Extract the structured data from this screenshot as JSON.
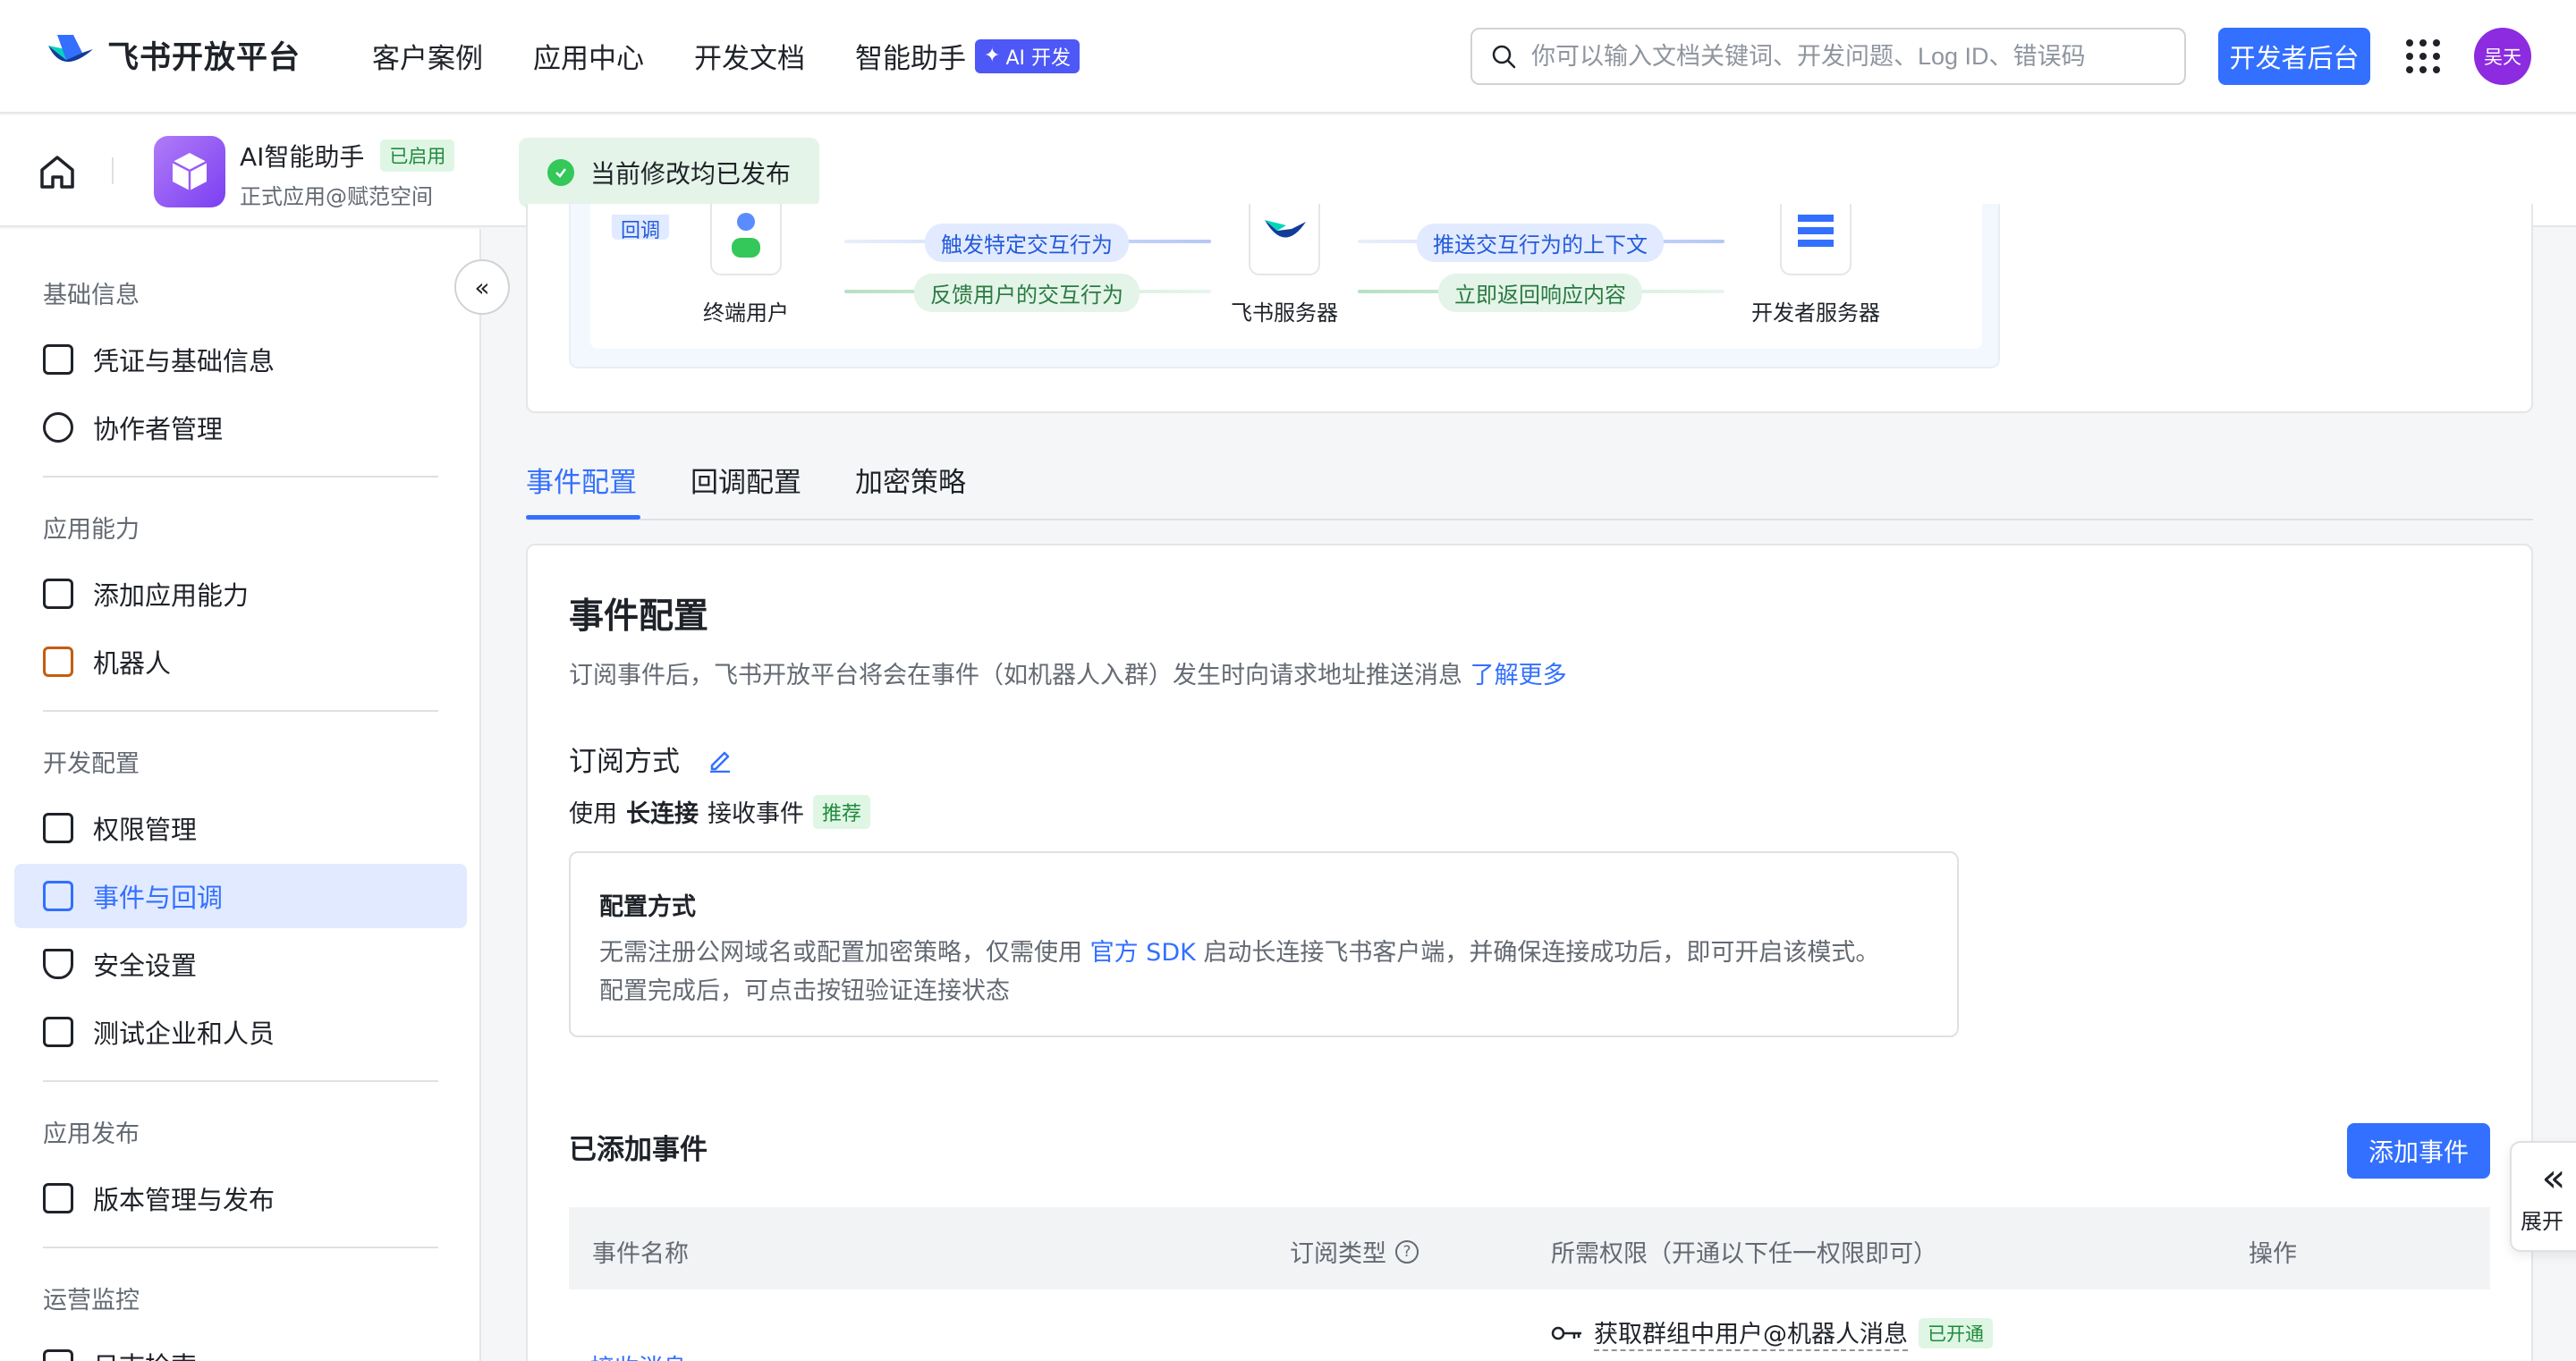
{
  "header": {
    "brand": "飞书开放平台",
    "nav": [
      {
        "label": "客户案例"
      },
      {
        "label": "应用中心"
      },
      {
        "label": "开发文档"
      },
      {
        "label": "智能助手"
      }
    ],
    "ai_badge": "AI 开发",
    "search_placeholder": "你可以输入文档关键词、开发问题、Log ID、错误码",
    "dev_console": "开发者后台",
    "avatar_text": "吴天"
  },
  "app": {
    "name": "AI智能助手",
    "status": "已启用",
    "subtitle": "正式应用@赋范空间",
    "toast": "当前修改均已发布"
  },
  "sidebar": {
    "groups": [
      {
        "title": "基础信息",
        "items": [
          "凭证与基础信息",
          "协作者管理"
        ]
      },
      {
        "title": "应用能力",
        "items": [
          "添加应用能力",
          "机器人"
        ]
      },
      {
        "title": "开发配置",
        "items": [
          "权限管理",
          "事件与回调",
          "安全设置",
          "测试企业和人员"
        ]
      },
      {
        "title": "应用发布",
        "items": [
          "版本管理与发布"
        ]
      },
      {
        "title": "运营监控",
        "items": [
          "日志检索"
        ]
      }
    ],
    "active": "事件与回调"
  },
  "flow": {
    "nodes": [
      "终端用户",
      "飞书服务器",
      "开发者服务器"
    ],
    "badge_partial": "回调",
    "arrows": [
      "触发特定交互行为",
      "反馈用户的交互行为",
      "推送交互行为的上下文",
      "立即返回响应内容"
    ]
  },
  "tabs": [
    "事件配置",
    "回调配置",
    "加密策略"
  ],
  "event_config": {
    "title": "事件配置",
    "desc": "订阅事件后，飞书开放平台将会在事件（如机器人入群）发生时向请求地址推送消息",
    "learn_more": "了解更多",
    "sub_title": "订阅方式",
    "sub_prefix": "使用",
    "sub_mode": "长连接",
    "sub_suffix": "接收事件",
    "recommend": "推荐",
    "cfg_title": "配置方式",
    "cfg_l1_a": "无需注册公网域名或配置加密策略，仅需使用",
    "cfg_l1_link": "官方 SDK",
    "cfg_l1_b": "启动长连接飞书客户端，并确保连接成功后，即可开启该模式。",
    "cfg_l2": "配置完成后，可点击按钮验证连接状态"
  },
  "added": {
    "title": "已添加事件",
    "add_btn": "添加事件",
    "columns": [
      "事件名称",
      "订阅类型",
      "所需权限（开通以下任一权限即可）",
      "操作"
    ],
    "rows": [
      {
        "event": "接收消息",
        "permission": "获取群组中用户@机器人消息",
        "perm_status": "已开通"
      }
    ]
  },
  "expand": {
    "label": "展开"
  }
}
